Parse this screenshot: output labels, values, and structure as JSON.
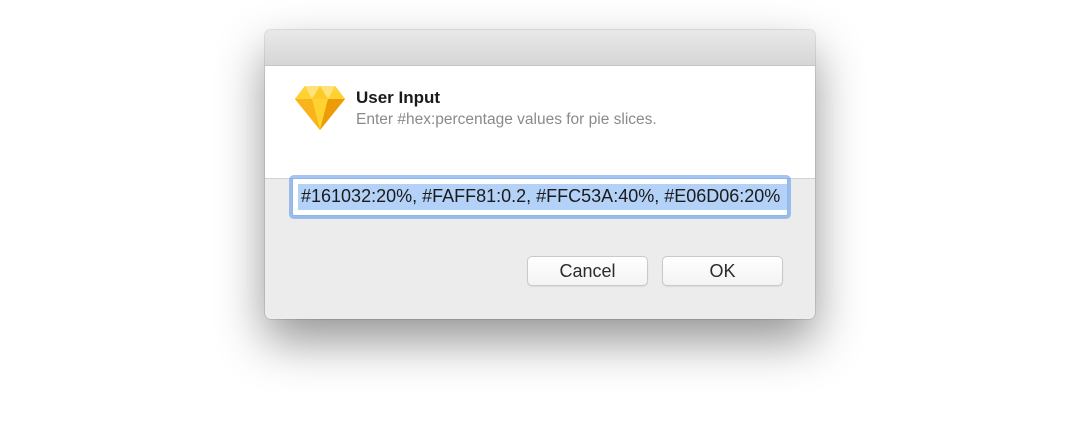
{
  "dialog": {
    "title": "User Input",
    "subtitle": "Enter #hex:percentage values for pie slices.",
    "app_icon": "sketch-diamond-icon",
    "input": {
      "value": "#161032:20%, #FAFF81:0.2, #FFC53A:40%, #E06D06:20%",
      "selected": true
    },
    "buttons": {
      "cancel_label": "Cancel",
      "ok_label": "OK"
    }
  },
  "colors": {
    "icon_top": "#FDD231",
    "icon_bottom": "#F7A30D",
    "selection": "#B4D2F7",
    "focus_ring": "#5A96EB"
  }
}
